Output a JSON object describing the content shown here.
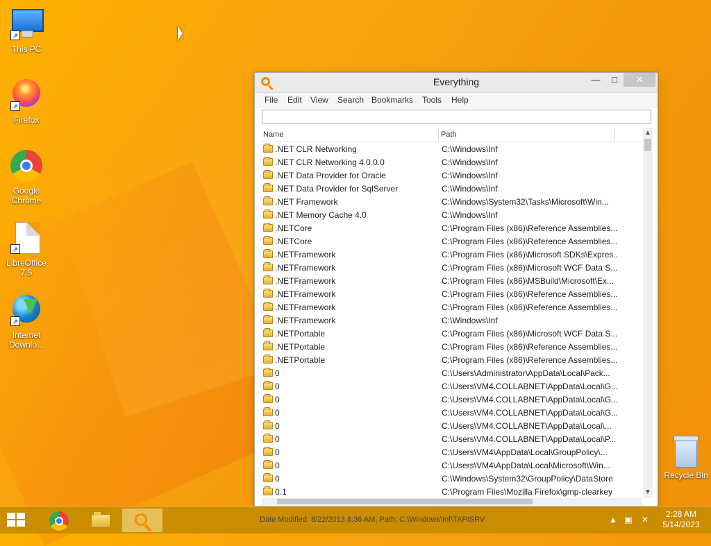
{
  "desktop": {
    "icons": [
      {
        "label": "This PC"
      },
      {
        "label": "Firefox"
      },
      {
        "label": "Google Chrome"
      },
      {
        "label": "LibreOffice 7.5"
      },
      {
        "label": "Internet Downlo..."
      }
    ],
    "recycle_bin": {
      "label": "Recycle Bin"
    }
  },
  "window": {
    "title": "Everything",
    "minimize_glyph": "—",
    "maximize_glyph": "□",
    "close_glyph": "✕",
    "menu": {
      "file": "File",
      "edit": "Edit",
      "view": "View",
      "search": "Search",
      "bookmarks": "Bookmarks",
      "tools": "Tools",
      "help": "Help"
    },
    "search": {
      "value": "",
      "placeholder": ""
    },
    "columns": {
      "name": "Name",
      "path": "Path"
    },
    "rows": [
      {
        "name": ".NET CLR Networking",
        "path": "C:\\Windows\\Inf"
      },
      {
        "name": ".NET CLR Networking 4.0.0.0",
        "path": "C:\\Windows\\Inf"
      },
      {
        "name": ".NET Data Provider for Oracle",
        "path": "C:\\Windows\\Inf"
      },
      {
        "name": ".NET Data Provider for SqlServer",
        "path": "C:\\Windows\\Inf"
      },
      {
        "name": ".NET Framework",
        "path": "C:\\Windows\\System32\\Tasks\\Microsoft\\Win..."
      },
      {
        "name": ".NET Memory Cache 4.0",
        "path": "C:\\Windows\\Inf"
      },
      {
        "name": ".NETCore",
        "path": "C:\\Program Files (x86)\\Reference Assemblies..."
      },
      {
        "name": ".NETCore",
        "path": "C:\\Program Files (x86)\\Reference Assemblies..."
      },
      {
        "name": ".NETFramework",
        "path": "C:\\Program Files (x86)\\Microsoft SDKs\\Expres..."
      },
      {
        "name": ".NETFramework",
        "path": "C:\\Program Files (x86)\\Microsoft WCF Data S..."
      },
      {
        "name": ".NETFramework",
        "path": "C:\\Program Files (x86)\\MSBuild\\Microsoft\\Ex..."
      },
      {
        "name": ".NETFramework",
        "path": "C:\\Program Files (x86)\\Reference Assemblies..."
      },
      {
        "name": ".NETFramework",
        "path": "C:\\Program Files (x86)\\Reference Assemblies..."
      },
      {
        "name": ".NETFramework",
        "path": "C:\\Windows\\Inf"
      },
      {
        "name": ".NETPortable",
        "path": "C:\\Program Files (x86)\\Microsoft WCF Data S..."
      },
      {
        "name": ".NETPortable",
        "path": "C:\\Program Files (x86)\\Reference Assemblies..."
      },
      {
        "name": ".NETPortable",
        "path": "C:\\Program Files (x86)\\Reference Assemblies..."
      },
      {
        "name": "0",
        "path": "C:\\Users\\Administrator\\AppData\\Local\\Pack..."
      },
      {
        "name": "0",
        "path": "C:\\Users\\VM4.COLLABNET\\AppData\\Local\\G..."
      },
      {
        "name": "0",
        "path": "C:\\Users\\VM4.COLLABNET\\AppData\\Local\\G..."
      },
      {
        "name": "0",
        "path": "C:\\Users\\VM4.COLLABNET\\AppData\\Local\\G..."
      },
      {
        "name": "0",
        "path": "C:\\Users\\VM4.COLLABNET\\AppData\\Local\\..."
      },
      {
        "name": "0",
        "path": "C:\\Users\\VM4.COLLABNET\\AppData\\Local\\P..."
      },
      {
        "name": "0",
        "path": "C:\\Users\\VM4\\AppData\\Local\\GroupPolicy\\..."
      },
      {
        "name": "0",
        "path": "C:\\Users\\VM4\\AppData\\Local\\Microsoft\\Win..."
      },
      {
        "name": "0",
        "path": "C:\\Windows\\System32\\GroupPolicy\\DataStore"
      },
      {
        "name": "0.1",
        "path": "C:\\Program Files\\Mozilla Firefox\\gmp-clearkey"
      }
    ],
    "status": "Date Modified: 8/22/2013 8:36 AM, Path: C:\\Windows\\Inf\\TAPISRV"
  },
  "taskbar": {
    "tray_up_glyph": "▲",
    "network_glyph": "▣",
    "volume_glyph": "✕",
    "time": "2:28 AM",
    "date": "5/14/2023"
  }
}
